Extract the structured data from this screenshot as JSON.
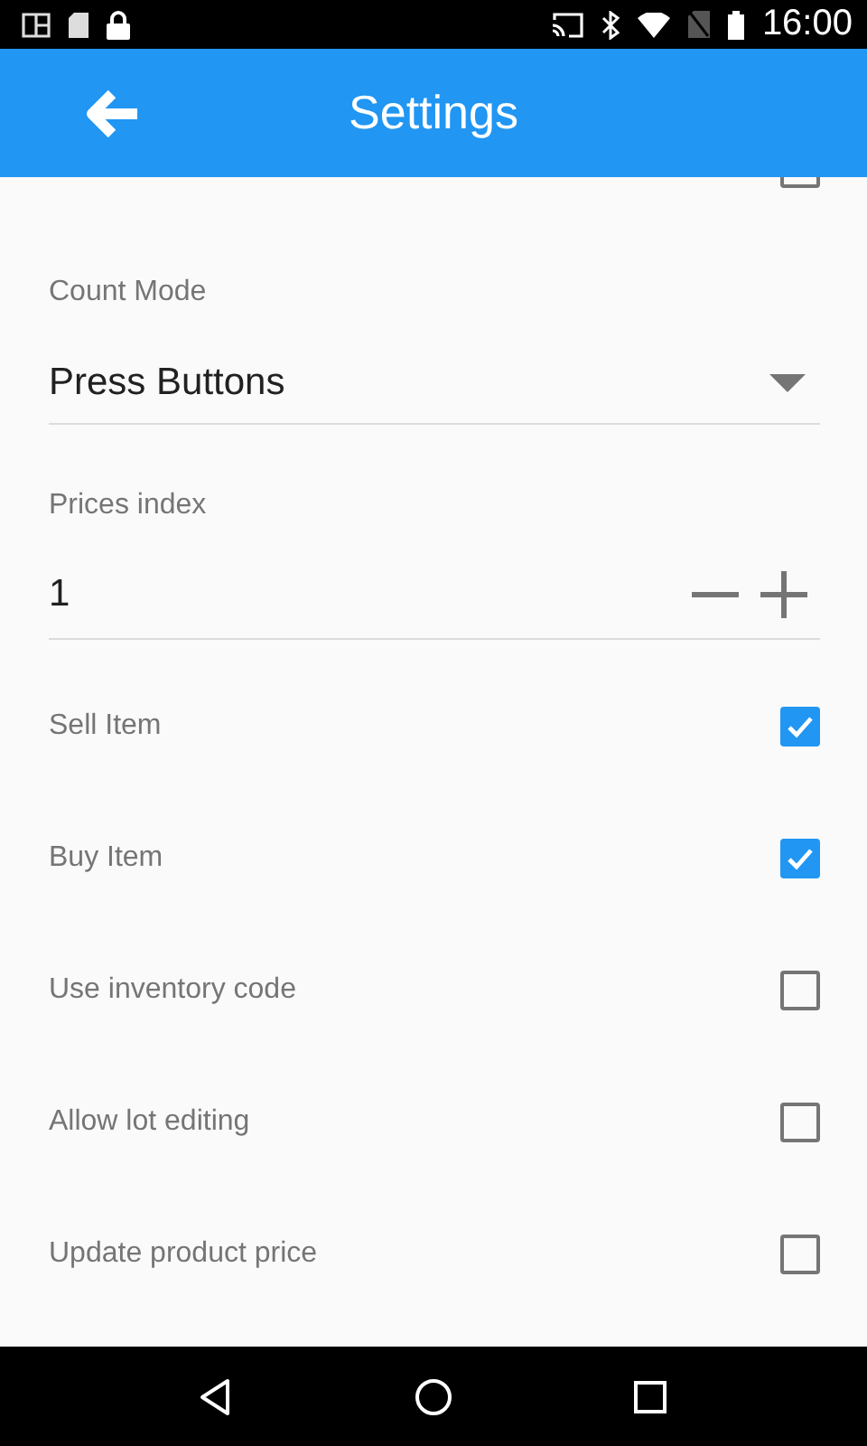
{
  "status_bar": {
    "time": "16:00"
  },
  "app_bar": {
    "title": "Settings"
  },
  "hidden_row": {
    "checked": false
  },
  "count_mode": {
    "label": "Count Mode",
    "value": "Press Buttons"
  },
  "prices_index": {
    "label": "Prices index",
    "value": "1"
  },
  "options": [
    {
      "label": "Sell Item",
      "checked": true
    },
    {
      "label": "Buy Item",
      "checked": true
    },
    {
      "label": "Use inventory code",
      "checked": false
    },
    {
      "label": "Allow lot editing",
      "checked": false
    },
    {
      "label": "Update product price",
      "checked": false
    }
  ]
}
